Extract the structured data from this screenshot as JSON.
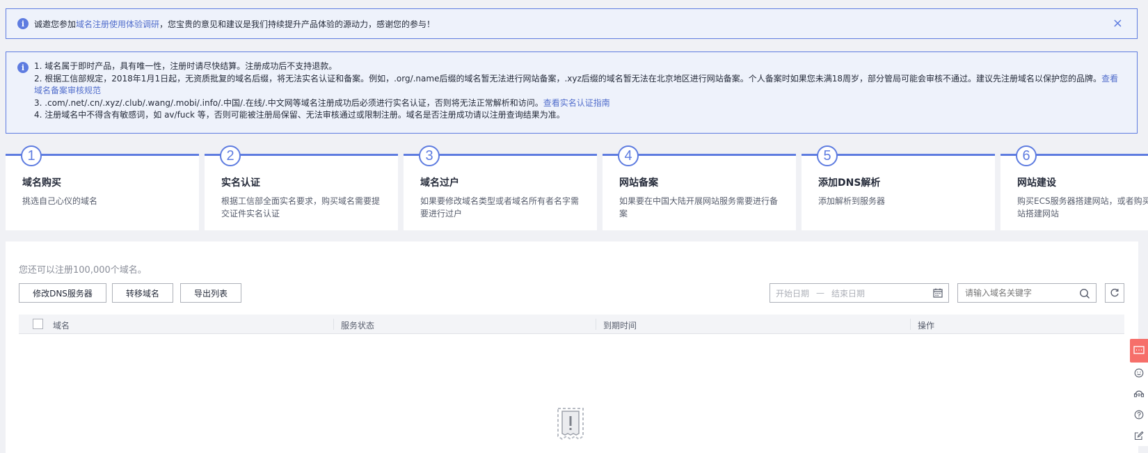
{
  "notice": {
    "prefix": "诚邀您参加",
    "link": "域名注册使用体验调研",
    "suffix": "，您宝贵的意见和建议是我们持续提升产品体验的源动力，感谢您的参与！",
    "close": "×"
  },
  "tips": {
    "line1": "1. 域名属于即时产品，具有唯一性，注册时请尽快结算。注册成功后不支持退款。",
    "line2": "2. 根据工信部规定，2018年1月1日起，无资质批复的域名后缀，将无法实名认证和备案。例如，.org/.name后缀的域名暂无法进行网站备案，.xyz后缀的域名暂无法在北京地区进行网站备案。个人备案时如果您未满18周岁，部分管局可能会审核不通过。建议先注册域名以保护您的品牌。",
    "line2_link": "查看域名备案审核规范",
    "line3": "3. .com/.net/.cn/.xyz/.club/.wang/.mobi/.info/.中国/.在线/.中文网等域名注册成功后必须进行实名认证，否则将无法正常解析和访问。",
    "line3_link": "查看实名认证指南",
    "line4": "4. 注册域名中不得含有敏感词，如 av/fuck 等，否则可能被注册局保留、无法审核通过或限制注册。域名是否注册成功请以注册查询结果为准。"
  },
  "steps": [
    {
      "num": "1",
      "title": "域名购买",
      "desc": "挑选自己心仪的域名"
    },
    {
      "num": "2",
      "title": "实名认证",
      "desc": "根据工信部全面实名要求，购买域名需要提交证件实名认证"
    },
    {
      "num": "3",
      "title": "域名过户",
      "desc": "如果要修改域名类型或者域名所有者名字需要进行过户"
    },
    {
      "num": "4",
      "title": "网站备案",
      "desc": "如果要在中国大陆开展网站服务需要进行备案"
    },
    {
      "num": "5",
      "title": "添加DNS解析",
      "desc": "添加解析到服务器"
    },
    {
      "num": "6",
      "title": "网站建设",
      "desc": "购买ECS服务器搭建网站，或者购买云速建站搭建网站"
    }
  ],
  "main": {
    "quota": "您还可以注册100,000个域名。",
    "btn_dns": "修改DNS服务器",
    "btn_transfer": "转移域名",
    "btn_export": "导出列表",
    "date_start": "开始日期",
    "date_sep": "—",
    "date_end": "结束日期",
    "search_placeholder": "请输入域名关键字"
  },
  "table": {
    "columns": [
      "域名",
      "服务状态",
      "到期时间",
      "操作"
    ]
  },
  "colors": {
    "accent": "#5e7ce0",
    "link": "#526ecc",
    "tool_active": "#f66f6a"
  }
}
